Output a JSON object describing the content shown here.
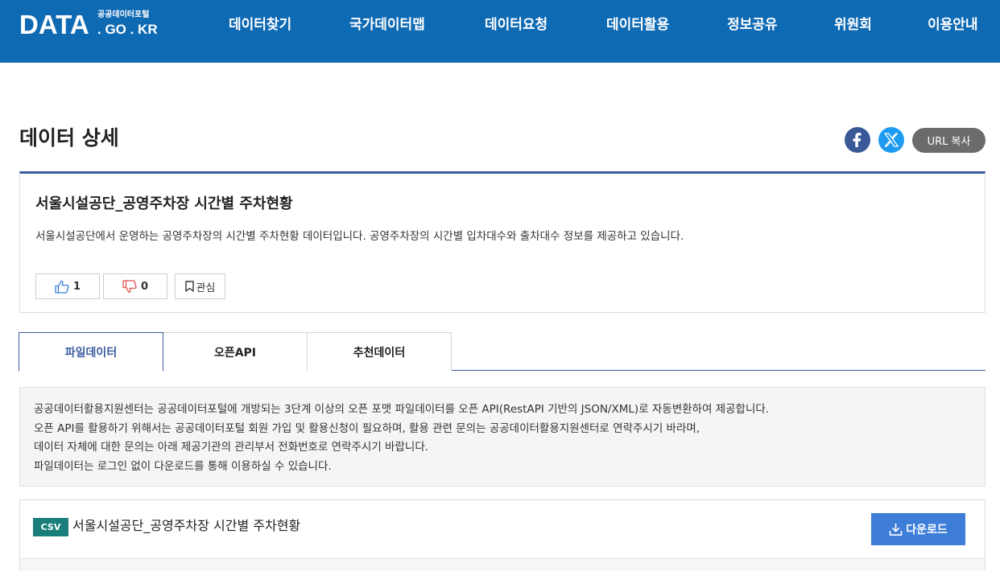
{
  "header": {
    "logo_main": "DATA",
    "logo_sub": "공공데이터포털",
    "logo_domain": ". GO . KR",
    "nav": [
      "데이터찾기",
      "국가데이터맵",
      "데이터요청",
      "데이터활용",
      "정보공유",
      "위원회",
      "이용안내"
    ]
  },
  "page": {
    "title": "데이터 상세",
    "url_copy_label": "URL 복사"
  },
  "summary": {
    "title": "서울시설공단_공영주차장 시간별 주차현황",
    "description": "서울시설공단에서 운영하는 공영주차장의 시간별 주차현황 데이터입니다. 공영주차장의 시간별 입차대수와 출차대수 정보를 제공하고 있습니다.",
    "likes": "1",
    "dislikes": "0",
    "favorite_label": "관심"
  },
  "tabs": [
    {
      "label": "파일데이터",
      "active": true
    },
    {
      "label": "오픈API",
      "active": false
    },
    {
      "label": "추천데이터",
      "active": false
    }
  ],
  "notice": {
    "lines": [
      "공공데이터활용지원센터는 공공데이터포털에 개방되는 3단계 이상의 오픈 포맷 파일데이터를 오픈 API(RestAPI 기반의 JSON/XML)로 자동변환하여 제공합니다.",
      "오픈 API를 활용하기 위해서는 공공데이터포털 회원 가입 및 활용신청이 필요하며, 활용 관련 문의는 공공데이터활용지원센터로 연락주시기 바라며,",
      "데이터 자체에 대한 문의는 아래 제공기관의 관리부서 전화번호로 연락주시기 바랍니다.",
      "파일데이터는 로그인 없이 다운로드를 통해 이용하실 수 있습니다."
    ]
  },
  "file": {
    "format": "CSV",
    "name": "서울시설공단_공영주차장 시간별 주차현황",
    "download_label": "다운로드"
  },
  "colors": {
    "header_bg": "#0f6ab4",
    "accent": "#3a5ba0",
    "download_bg": "#3e7dd8",
    "csv_badge": "#1a7f7a",
    "facebook": "#3b5998",
    "x_twitter": "#1d9bf0"
  }
}
